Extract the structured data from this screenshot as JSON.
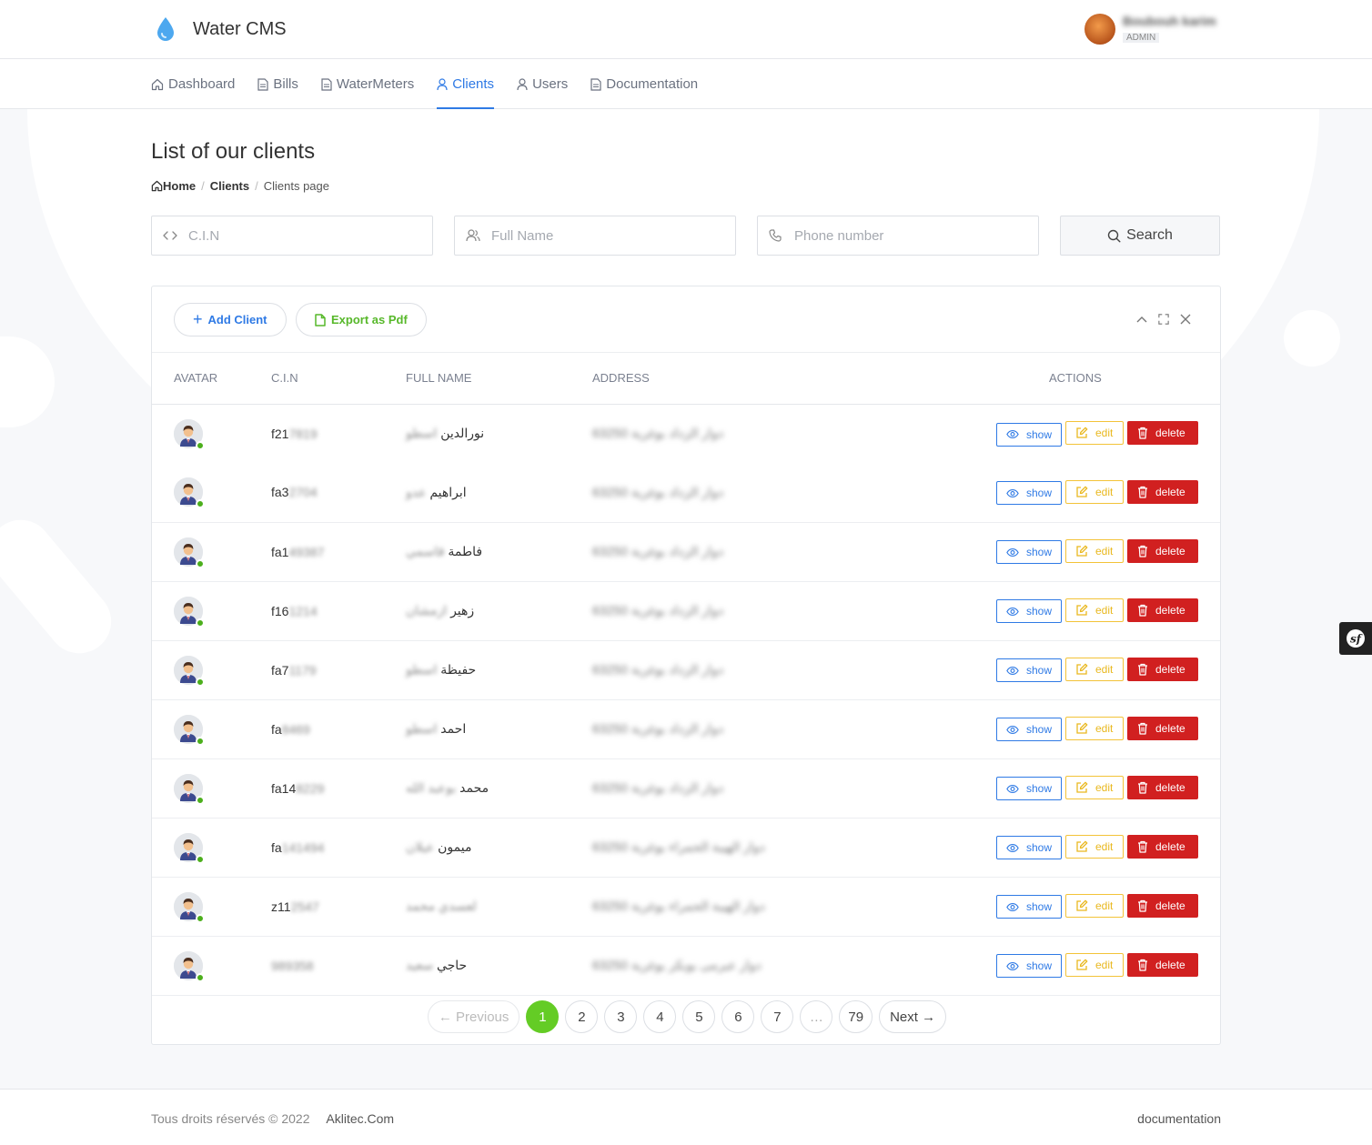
{
  "app": {
    "title": "Water CMS"
  },
  "user": {
    "name": "Boubouh karim",
    "role": "ADMIN"
  },
  "nav": {
    "items": [
      {
        "label": "Dashboard",
        "icon": "home-icon"
      },
      {
        "label": "Bills",
        "icon": "document-icon"
      },
      {
        "label": "WaterMeters",
        "icon": "document-icon"
      },
      {
        "label": "Clients",
        "icon": "user-icon"
      },
      {
        "label": "Users",
        "icon": "user-icon"
      },
      {
        "label": "Documentation",
        "icon": "document-icon"
      }
    ],
    "active": "Clients"
  },
  "page": {
    "title": "List of our clients",
    "breadcrumb": {
      "home": "Home",
      "section": "Clients",
      "current": "Clients page"
    }
  },
  "filters": {
    "cin_placeholder": "C.I.N",
    "name_placeholder": "Full Name",
    "phone_placeholder": "Phone number",
    "search_label": "Search"
  },
  "card": {
    "add_label": "Add Client",
    "export_label": "Export as Pdf"
  },
  "table": {
    "headers": {
      "avatar": "AVATAR",
      "cin": "C.I.N",
      "name": "FULL NAME",
      "address": "ADDRESS",
      "actions": "ACTIONS"
    },
    "action_labels": {
      "show": "show",
      "edit": "edit",
      "delete": "delete"
    },
    "rows": [
      {
        "cin_visible": "f21",
        "cin_hidden": "7819",
        "name_visible": "نورالدين",
        "name_hidden": "اسطو",
        "address": "دوار الزداد بوغرية 63250"
      },
      {
        "cin_visible": "fa3",
        "cin_hidden": "2704",
        "name_visible": "ابراهيم",
        "name_hidden": "عدو",
        "address": "دوار الزداد بوغرية 63250"
      },
      {
        "cin_visible": "fa1",
        "cin_hidden": "49387",
        "name_visible": "فاطمة",
        "name_hidden": "قاسمي",
        "address": "دوار الزداد بوغرية 63250"
      },
      {
        "cin_visible": "f16",
        "cin_hidden": "1214",
        "name_visible": "زهير",
        "name_hidden": "ازمشان",
        "address": "دوار الزداد بوغرية 63250"
      },
      {
        "cin_visible": "fa7",
        "cin_hidden": "1179",
        "name_visible": "حفيظة",
        "name_hidden": "اسطو",
        "address": "دوار الزداد بوغرية 63250"
      },
      {
        "cin_visible": "fa",
        "cin_hidden": "8469",
        "name_visible": "احمد",
        "name_hidden": "اسطو",
        "address": "دوار الزداد بوغرية 63250"
      },
      {
        "cin_visible": "fa14",
        "cin_hidden": "8229",
        "name_visible": "محمد",
        "name_hidden": "بوعبد الله",
        "address": "دوار الزداد بوغرية 63250"
      },
      {
        "cin_visible": "fa",
        "cin_hidden": "141494",
        "name_visible": "ميمون",
        "name_hidden": "عيلان",
        "address": "دوار الهيبة الحمراء بوغرية 63250"
      },
      {
        "cin_visible": "z11",
        "cin_hidden": "2547",
        "name_visible": "",
        "name_hidden": "لعسدي محمد",
        "address": "دوار الهيبة الحمراء بوغرية 63250"
      },
      {
        "cin_visible": "",
        "cin_hidden": "989358",
        "name_visible": "حاجي",
        "name_hidden": "سعيد",
        "address": "دوار عبرمى بوبكر بوغرية 63250"
      }
    ]
  },
  "pagination": {
    "previous": "← Previous",
    "pages": [
      "1",
      "2",
      "3",
      "4",
      "5",
      "6",
      "7",
      "…",
      "79"
    ],
    "active_page": "1",
    "next": "Next →"
  },
  "footer": {
    "copyright": "Tous droits réservés © 2022",
    "brand": "Aklitec.Com",
    "doc_link": "documentation"
  },
  "colors": {
    "primary": "#2f7ae5",
    "success": "#64cc25",
    "warning": "#f3c338",
    "danger": "#d12020"
  }
}
